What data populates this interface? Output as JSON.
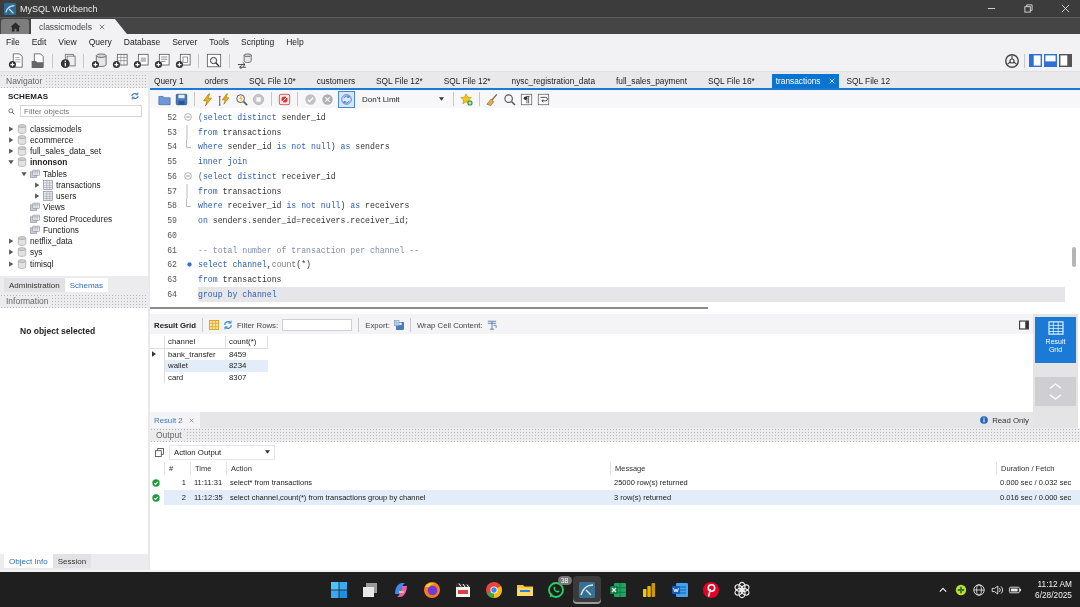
{
  "window": {
    "title": "MySQL Workbench"
  },
  "connection_tabs": [
    {
      "label": "classicmodels",
      "selected": true
    }
  ],
  "menu": [
    "File",
    "Edit",
    "View",
    "Query",
    "Database",
    "Server",
    "Tools",
    "Scripting",
    "Help"
  ],
  "panel_toggles": [
    {
      "kind": "sidebar",
      "on": true
    },
    {
      "kind": "output",
      "on": true
    },
    {
      "kind": "secondary_sidebar",
      "on": false
    }
  ],
  "navigator": {
    "title": "Navigator",
    "section": "SCHEMAS",
    "filter": {
      "placeholder": "Filter objects"
    },
    "tree": [
      {
        "label": "classicmodels",
        "kind": "schema",
        "expanded": false,
        "default": false
      },
      {
        "label": "ecommerce",
        "kind": "schema",
        "expanded": false,
        "default": false
      },
      {
        "label": "full_sales_data_set",
        "kind": "schema",
        "expanded": false,
        "default": false
      },
      {
        "label": "innonson",
        "kind": "schema",
        "expanded": true,
        "default": true,
        "children": [
          {
            "label": "Tables",
            "kind": "folder",
            "expanded": true,
            "children": [
              {
                "label": "transactions",
                "kind": "table",
                "expanded": false
              },
              {
                "label": "users",
                "kind": "table",
                "expanded": false
              }
            ]
          },
          {
            "label": "Views",
            "kind": "folder"
          },
          {
            "label": "Stored Procedures",
            "kind": "folder"
          },
          {
            "label": "Functions",
            "kind": "folder"
          }
        ]
      },
      {
        "label": "netflix_data",
        "kind": "schema",
        "expanded": false,
        "default": false
      },
      {
        "label": "sys",
        "kind": "schema",
        "expanded": false,
        "default": false
      },
      {
        "label": "timisql",
        "kind": "schema",
        "expanded": false,
        "default": false
      }
    ],
    "tabs": [
      {
        "label": "Administration",
        "selected": false
      },
      {
        "label": "Schemas",
        "selected": true
      }
    ],
    "info_title": "Information",
    "info_text": "No object selected",
    "bottom_tabs": [
      {
        "label": "Object Info",
        "selected": true
      },
      {
        "label": "Session",
        "selected": false
      }
    ]
  },
  "query_tabs": [
    {
      "label": "Query 1",
      "selected": false
    },
    {
      "label": "orders",
      "selected": false
    },
    {
      "label": "SQL File 10*",
      "selected": false
    },
    {
      "label": "customers",
      "selected": false
    },
    {
      "label": "SQL File 12*",
      "selected": false
    },
    {
      "label": "SQL File 12*",
      "selected": false
    },
    {
      "label": "nysc_registration_data",
      "selected": false
    },
    {
      "label": "full_sales_payment",
      "selected": false
    },
    {
      "label": "SQL File 16*",
      "selected": false
    },
    {
      "label": "transactions",
      "selected": true
    },
    {
      "label": "SQL File 12",
      "selected": false
    }
  ],
  "editor_toolbar": {
    "buttons": [
      {
        "kind": "open",
        "disabled": false
      },
      {
        "kind": "save",
        "disabled": false
      },
      {
        "kind": "execute",
        "disabled": false
      },
      {
        "kind": "execute_current",
        "disabled": false
      },
      {
        "kind": "explain",
        "disabled": false
      },
      {
        "kind": "stop",
        "disabled": true
      },
      {
        "kind": "toggle_continue",
        "disabled": false
      },
      {
        "kind": "commit",
        "disabled": true
      },
      {
        "kind": "rollback",
        "disabled": true
      },
      {
        "kind": "autocommit",
        "disabled": false
      }
    ],
    "autocommit_on": true,
    "limit": "Don't Limit",
    "tools": [
      {
        "kind": "snippet"
      },
      {
        "kind": "beautify"
      },
      {
        "kind": "find"
      },
      {
        "kind": "invisibles"
      },
      {
        "kind": "wrap"
      }
    ]
  },
  "editor": {
    "lines": [
      {
        "number": "52",
        "fold_start": true,
        "fold_end": false,
        "marker": false,
        "current": false,
        "tokens": [
          {
            "text": "(select distinct",
            "kind": "keyword"
          },
          {
            "text": " sender_id",
            "kind": "plain"
          }
        ]
      },
      {
        "number": "53",
        "fold_start": false,
        "fold_end": false,
        "marker": false,
        "current": false,
        "tokens": [
          {
            "text": "from",
            "kind": "keyword"
          },
          {
            "text": " transactions",
            "kind": "plain"
          }
        ]
      },
      {
        "number": "54",
        "fold_start": false,
        "fold_end": true,
        "marker": false,
        "current": false,
        "tokens": [
          {
            "text": "where",
            "kind": "keyword"
          },
          {
            "text": " sender_id ",
            "kind": "plain"
          },
          {
            "text": "is not null",
            "kind": "keyword"
          },
          {
            "text": ") ",
            "kind": "plain"
          },
          {
            "text": "as",
            "kind": "keyword"
          },
          {
            "text": " senders",
            "kind": "plain"
          }
        ]
      },
      {
        "number": "55",
        "fold_start": false,
        "fold_end": false,
        "marker": false,
        "current": false,
        "tokens": [
          {
            "text": "inner join",
            "kind": "keyword"
          }
        ]
      },
      {
        "number": "56",
        "fold_start": true,
        "fold_end": false,
        "marker": false,
        "current": false,
        "tokens": [
          {
            "text": "(select distinct",
            "kind": "keyword"
          },
          {
            "text": " receiver_id",
            "kind": "plain"
          }
        ]
      },
      {
        "number": "57",
        "fold_start": false,
        "fold_end": false,
        "marker": false,
        "current": false,
        "tokens": [
          {
            "text": "from",
            "kind": "keyword"
          },
          {
            "text": " transactions",
            "kind": "plain"
          }
        ]
      },
      {
        "number": "58",
        "fold_start": false,
        "fold_end": true,
        "marker": false,
        "current": false,
        "tokens": [
          {
            "text": "where",
            "kind": "keyword"
          },
          {
            "text": " receiver_id ",
            "kind": "plain"
          },
          {
            "text": "is not null",
            "kind": "keyword"
          },
          {
            "text": ") ",
            "kind": "plain"
          },
          {
            "text": "as",
            "kind": "keyword"
          },
          {
            "text": " receivers",
            "kind": "plain"
          }
        ]
      },
      {
        "number": "59",
        "fold_start": false,
        "fold_end": false,
        "marker": false,
        "current": false,
        "tokens": [
          {
            "text": "on",
            "kind": "keyword"
          },
          {
            "text": " senders.sender_id=receivers.receiver_id;",
            "kind": "plain"
          }
        ]
      },
      {
        "number": "60",
        "fold_start": false,
        "fold_end": false,
        "marker": false,
        "current": false
      },
      {
        "number": "61",
        "fold_start": false,
        "fold_end": false,
        "marker": false,
        "current": false,
        "tokens": [
          {
            "text": "-- total number of transaction per channel --",
            "kind": "comment"
          }
        ]
      },
      {
        "number": "62",
        "fold_start": false,
        "fold_end": false,
        "marker": true,
        "current": false,
        "tokens": [
          {
            "text": "select channel",
            "kind": "keyword"
          },
          {
            "text": ",",
            "kind": "plain"
          },
          {
            "text": "count",
            "kind": "function"
          },
          {
            "text": "(*)",
            "kind": "plain"
          }
        ]
      },
      {
        "number": "63",
        "fold_start": false,
        "fold_end": false,
        "marker": false,
        "current": false,
        "tokens": [
          {
            "text": "from",
            "kind": "keyword"
          },
          {
            "text": " transactions",
            "kind": "plain"
          }
        ]
      },
      {
        "number": "64",
        "fold_start": false,
        "fold_end": false,
        "marker": false,
        "current": true,
        "tokens": [
          {
            "text": "group by channel",
            "kind": "keyword"
          }
        ]
      }
    ]
  },
  "results": {
    "toolbar": {
      "title": "Result Grid",
      "filter_label": "Filter Rows:",
      "export_label": "Export:",
      "wrap_label": "Wrap Cell Content:"
    },
    "grid": {
      "columns": [
        "channel",
        "count(*)"
      ],
      "rows": [
        {
          "cells": [
            "bank_transfer",
            "8459"
          ],
          "cursor": true,
          "selected": false
        },
        {
          "cells": [
            "wallet",
            "8234"
          ],
          "cursor": false,
          "selected": true
        },
        {
          "cells": [
            "card",
            "8307"
          ],
          "cursor": false,
          "selected": false
        }
      ]
    },
    "side_tabs": [
      {
        "label": "Result Grid",
        "selected": true
      }
    ],
    "tabs": [
      {
        "label": "Result 2",
        "selected": true
      }
    ],
    "status": "Read Only"
  },
  "output": {
    "title": "Output",
    "mode": "Action Output",
    "columns": [
      "#",
      "Time",
      "Action",
      "Message",
      "Duration / Fetch"
    ],
    "rows": [
      {
        "succeeded": true,
        "index": "1",
        "time": "11:11:31",
        "action": "select* from transactions",
        "message": "25000 row(s) returned",
        "duration": "0.000 sec / 0.032 sec",
        "selected": false
      },
      {
        "succeeded": true,
        "index": "2",
        "time": "11:12:35",
        "action": "select channel,count(*) from transactions group by channel",
        "message": "3 row(s) returned",
        "duration": "0.016 sec / 0.000 sec",
        "selected": true
      }
    ]
  },
  "taskbar": {
    "apps": [
      {
        "kind": "start",
        "active": false
      },
      {
        "kind": "task_view",
        "active": false
      },
      {
        "kind": "copilot",
        "active": false
      },
      {
        "kind": "firefox",
        "active": false
      },
      {
        "kind": "media_player",
        "active": false
      },
      {
        "kind": "chrome",
        "active": false
      },
      {
        "kind": "file_explorer",
        "active": false
      },
      {
        "kind": "whatsapp",
        "active": false,
        "badge": "38"
      },
      {
        "kind": "workbench",
        "active": true
      },
      {
        "kind": "excel",
        "active": false
      },
      {
        "kind": "power_bi",
        "active": false
      },
      {
        "kind": "word",
        "active": false
      },
      {
        "kind": "pinterest",
        "active": false
      },
      {
        "kind": "chatgpt",
        "active": false
      }
    ],
    "tray": [
      {
        "kind": "chevron"
      },
      {
        "kind": "app"
      },
      {
        "kind": "network"
      },
      {
        "kind": "volume"
      },
      {
        "kind": "battery"
      }
    ],
    "time": "11:12 AM",
    "date": "6/28/2025"
  }
}
